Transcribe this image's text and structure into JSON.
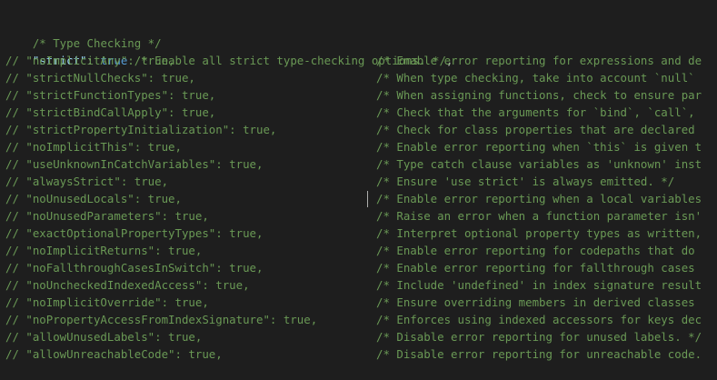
{
  "editor": {
    "section_comment": "/* Type Checking */",
    "strict_line": {
      "key": "\"strict\"",
      "colon": ": ",
      "value": "true",
      "comment": " /* Enable all strict type-checking options. */",
      "comma": ","
    },
    "lines": [
      {
        "setting": "// \"noImplicitAny\": true,",
        "desc": "/* Enable error reporting for expressions and de"
      },
      {
        "setting": "// \"strictNullChecks\": true,",
        "desc": "/* When type checking, take into account `null`"
      },
      {
        "setting": "// \"strictFunctionTypes\": true,",
        "desc": "/* When assigning functions, check to ensure par"
      },
      {
        "setting": "// \"strictBindCallApply\": true,",
        "desc": "/* Check that the arguments for `bind`, `call`,"
      },
      {
        "setting": "// \"strictPropertyInitialization\": true,",
        "desc": "/* Check for class properties that are declared"
      },
      {
        "setting": "// \"noImplicitThis\": true,",
        "desc": "/* Enable error reporting when `this` is given t"
      },
      {
        "setting": "// \"useUnknownInCatchVariables\": true,",
        "desc": "/* Type catch clause variables as 'unknown' inst"
      },
      {
        "setting": "// \"alwaysStrict\": true,",
        "desc": "/* Ensure 'use strict' is always emitted. */"
      },
      {
        "setting": "// \"noUnusedLocals\": true,",
        "desc": "/* Enable error reporting when a local variables"
      },
      {
        "setting": "// \"noUnusedParameters\": true,",
        "desc": "/* Raise an error when a function parameter isn'"
      },
      {
        "setting": "// \"exactOptionalPropertyTypes\": true,",
        "desc": "/* Interpret optional property types as written,"
      },
      {
        "setting": "// \"noImplicitReturns\": true,",
        "desc": "/* Enable error reporting for codepaths that do"
      },
      {
        "setting": "// \"noFallthroughCasesInSwitch\": true,",
        "desc": "/* Enable error reporting for fallthrough cases"
      },
      {
        "setting": "// \"noUncheckedIndexedAccess\": true,",
        "desc": "/* Include 'undefined' in index signature result"
      },
      {
        "setting": "// \"noImplicitOverride\": true,",
        "desc": "/* Ensure overriding members in derived classes"
      },
      {
        "setting": "// \"noPropertyAccessFromIndexSignature\": true,",
        "desc": "/* Enforces using indexed accessors for keys dec"
      },
      {
        "setting": "// \"allowUnusedLabels\": true,",
        "desc": "/* Disable error reporting for unused labels. */"
      },
      {
        "setting": "// \"allowUnreachableCode\": true,",
        "desc": "/* Disable error reporting for unreachable code."
      }
    ]
  },
  "colors": {
    "background": "#1e1e1e",
    "comment": "#6a9955",
    "key": "#9cdcfe",
    "boolean": "#569cd6",
    "punctuation": "#d4d4d4"
  }
}
